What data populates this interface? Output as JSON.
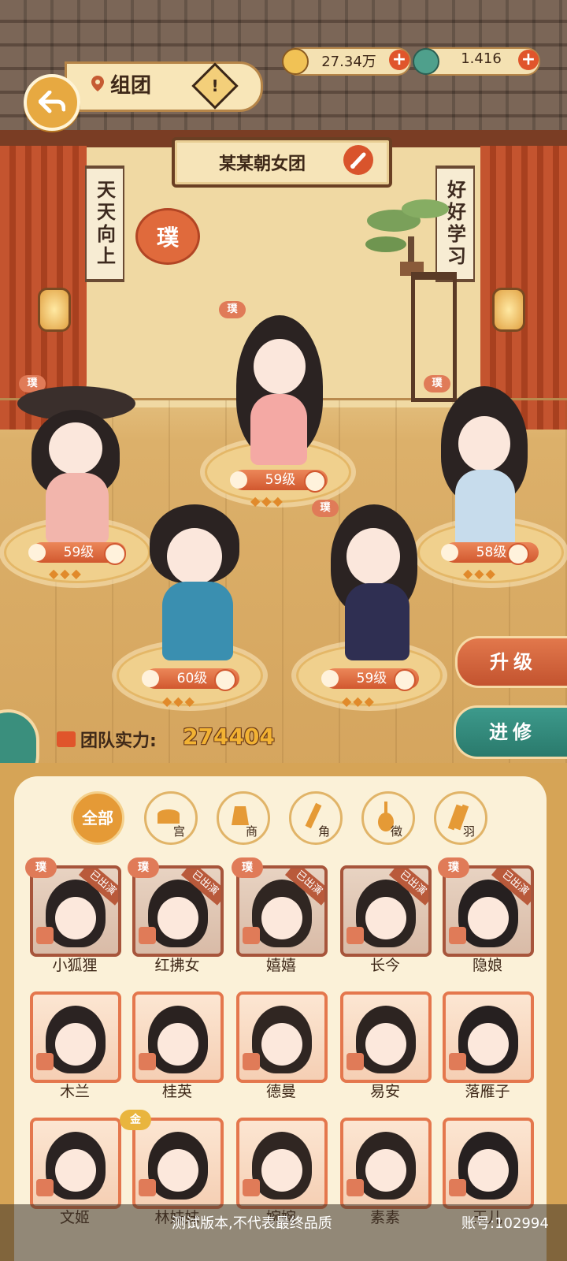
{
  "header": {
    "title": "组团"
  },
  "currency": [
    {
      "icon": "coin-icon",
      "value": "27.34万"
    },
    {
      "icon": "jade-icon",
      "value": "1.416"
    }
  ],
  "team": {
    "name": "某某朝女团",
    "power_label": "团队实力:",
    "power_value": "274404"
  },
  "scrolls": {
    "left": "天天向上",
    "right": "好好学习"
  },
  "seal_text": "璞",
  "stage": [
    {
      "id": "center",
      "level": "59级",
      "tag": "璞"
    },
    {
      "id": "left",
      "level": "59级",
      "tag": "璞"
    },
    {
      "id": "right",
      "level": "58级",
      "tag": "璞"
    },
    {
      "id": "front-left",
      "level": "60级"
    },
    {
      "id": "front-right",
      "level": "59级",
      "tag": "璞"
    }
  ],
  "buttons": {
    "upgrade": "升级",
    "advance": "进修"
  },
  "filters": [
    {
      "label": "全部",
      "active": true
    },
    {
      "label": "宫"
    },
    {
      "label": "商"
    },
    {
      "label": "角"
    },
    {
      "label": "徵"
    },
    {
      "label": "羽"
    }
  ],
  "card_badge": "已出演",
  "card_seal": "璞",
  "gold_badge": "金",
  "roster": [
    {
      "name": "小狐狸",
      "deployed": true
    },
    {
      "name": "红拂女",
      "deployed": true
    },
    {
      "name": "嬉嬉",
      "deployed": true
    },
    {
      "name": "长今",
      "deployed": true
    },
    {
      "name": "隐娘",
      "deployed": true
    },
    {
      "name": "木兰"
    },
    {
      "name": "桂英"
    },
    {
      "name": "德曼"
    },
    {
      "name": "易安"
    },
    {
      "name": "落雁子"
    },
    {
      "name": "文姬"
    },
    {
      "name": "林妹妹"
    },
    {
      "name": "婉婉"
    },
    {
      "name": "素素"
    },
    {
      "name": "玉儿"
    }
  ],
  "footer": {
    "notice": "测试版本,不代表最终品质",
    "account": "账号:102994"
  },
  "colors": {
    "accent": "#e0552b",
    "gold": "#e59a36",
    "teal": "#2a7a6c",
    "panel": "#fbf1d8"
  }
}
